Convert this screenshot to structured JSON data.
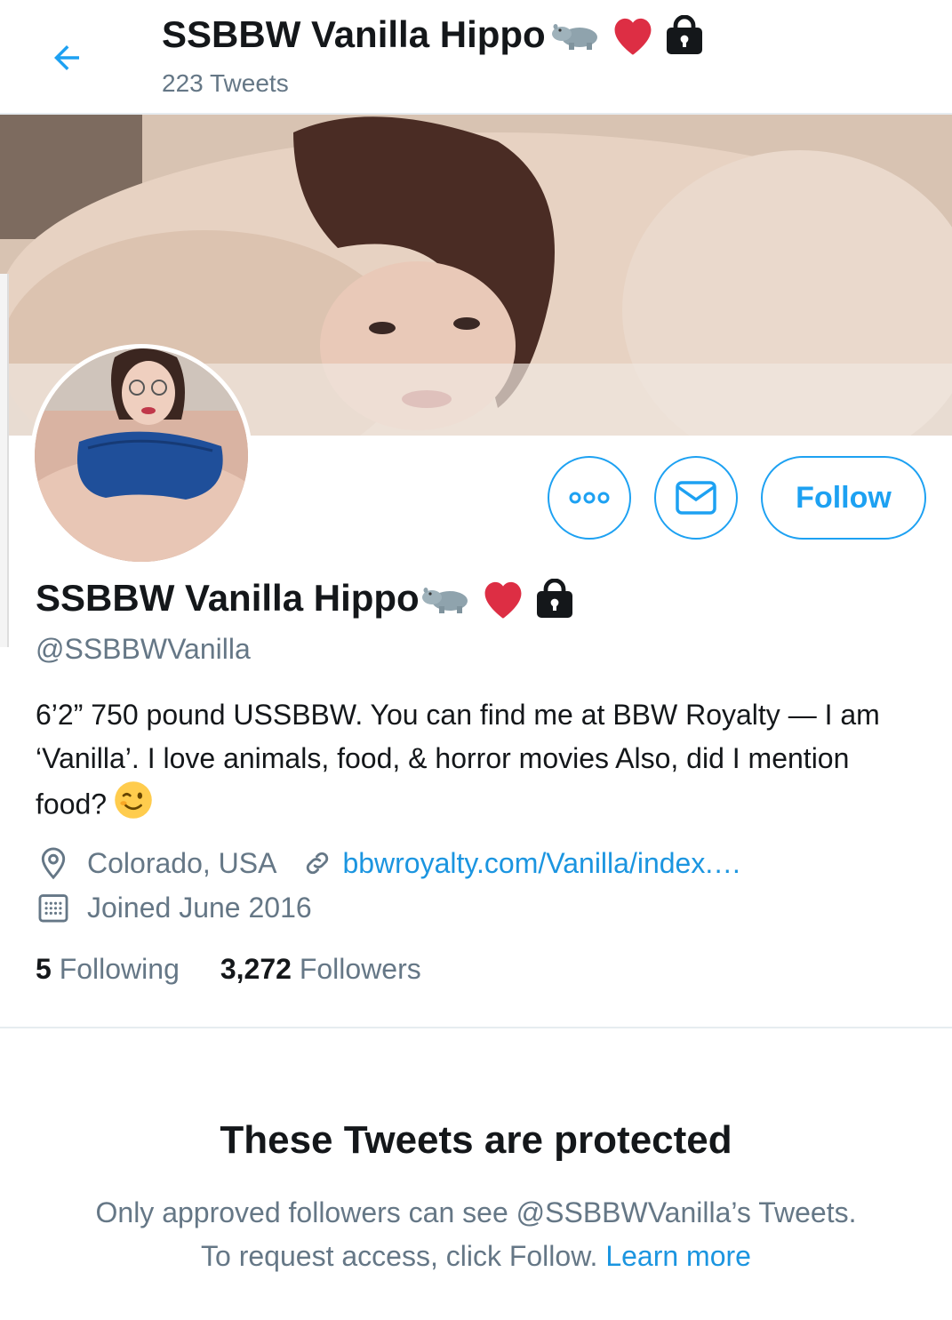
{
  "header": {
    "name": "SSBBW Vanilla Hippo",
    "tweet_count": "223 Tweets"
  },
  "profile": {
    "name": "SSBBW Vanilla Hippo",
    "handle": "@SSBBWVanilla",
    "name_emojis": [
      "hippo-icon",
      "heart-icon",
      "lock-icon"
    ],
    "bio": "6’2” 750 pound USSBBW. You can find me at BBW Royalty — I am ‘Vanilla’. I love animals, food, & horror movies Also, did I mention food?",
    "bio_emoji": "winking-face-icon",
    "location": "Colorado, USA",
    "website": "bbwroyalty.com/Vanilla/index.…",
    "joined": "Joined June 2016"
  },
  "actions": {
    "follow_label": "Follow"
  },
  "stats": {
    "following_count": "5",
    "following_label": "Following",
    "followers_count": "3,272",
    "followers_label": "Followers"
  },
  "protected": {
    "title": "These Tweets are protected",
    "line1": "Only approved followers can see @SSBBWVanilla’s Tweets.",
    "line2": "To request access, click Follow.",
    "learn_more": "Learn more"
  },
  "colors": {
    "accent": "#1da1f2",
    "link": "#1b95e0",
    "secondary_text": "#657786",
    "heart": "#e0245e"
  }
}
